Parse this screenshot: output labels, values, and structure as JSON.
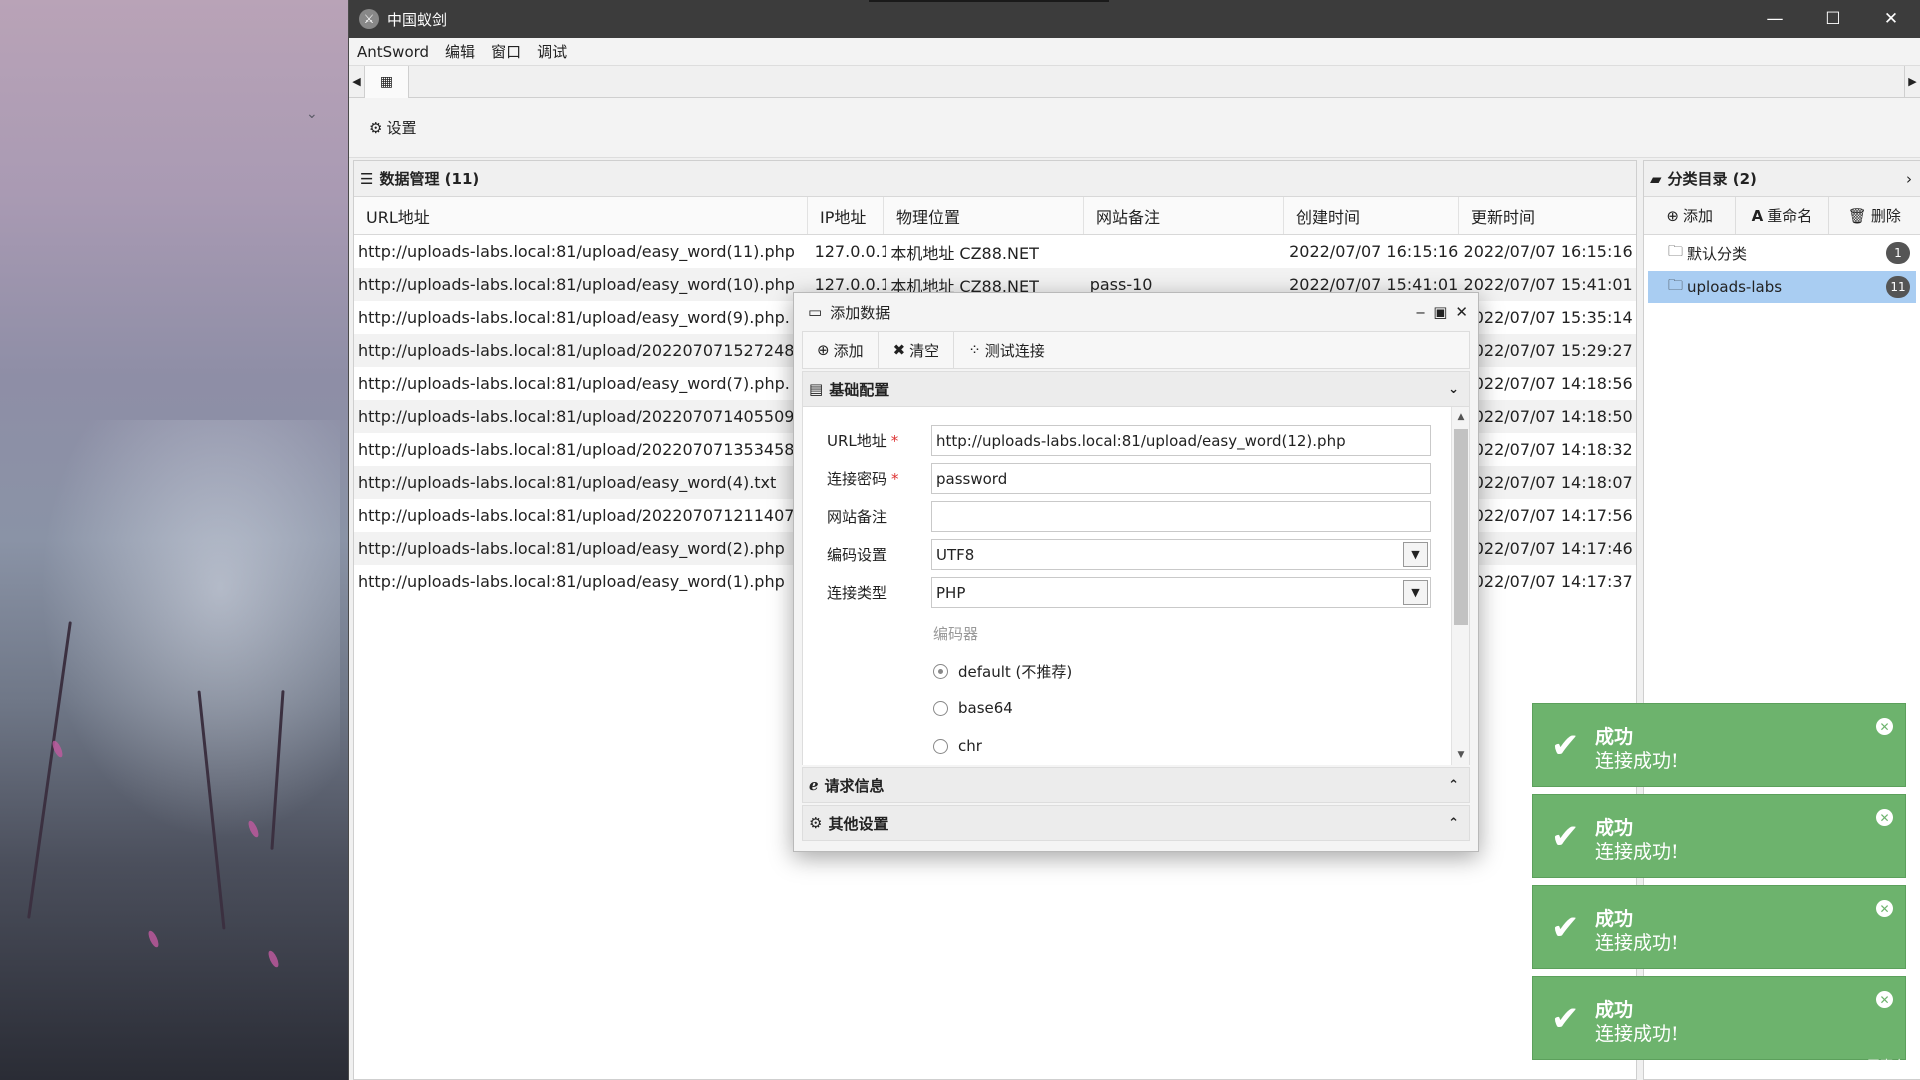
{
  "window": {
    "title": "中国蚁剑"
  },
  "menu": [
    "AntSword",
    "编辑",
    "窗口",
    "调试"
  ],
  "toolbar": {
    "settings_label": "设置"
  },
  "data_panel": {
    "title": "数据管理 (11)",
    "columns": [
      "URL地址",
      "IP地址",
      "物理位置",
      "网站备注",
      "创建时间",
      "更新时间"
    ],
    "rows": [
      [
        "http://uploads-labs.local:81/upload/easy_word(11).php",
        "127.0.0.1",
        "本机地址 CZ88.NET",
        "",
        "2022/07/07 16:15:16",
        "2022/07/07 16:15:16"
      ],
      [
        "http://uploads-labs.local:81/upload/easy_word(10).php",
        "127.0.0.1",
        "本机地址 CZ88.NET",
        "pass-10",
        "2022/07/07 15:41:01",
        "2022/07/07 15:41:01"
      ],
      [
        "http://uploads-labs.local:81/upload/easy_word(9).php.",
        "",
        "",
        "",
        "",
        "2022/07/07 15:35:14"
      ],
      [
        "http://uploads-labs.local:81/upload/202207071527248562.pl",
        "",
        "",
        "",
        "",
        "2022/07/07 15:29:27"
      ],
      [
        "http://uploads-labs.local:81/upload/easy_word(7).php.",
        "",
        "",
        "",
        "",
        "2022/07/07 14:18:56"
      ],
      [
        "http://uploads-labs.local:81/upload/202207071405509988.pl",
        "",
        "",
        "",
        "",
        "2022/07/07 14:18:50"
      ],
      [
        "http://uploads-labs.local:81/upload/202207071353458184.Pl",
        "",
        "",
        "",
        "",
        "2022/07/07 14:18:32"
      ],
      [
        "http://uploads-labs.local:81/upload/easy_word(4).txt",
        "",
        "",
        "",
        "",
        "2022/07/07 14:18:07"
      ],
      [
        "http://uploads-labs.local:81/upload/202207071211407194.pl",
        "",
        "",
        "",
        "",
        "2022/07/07 14:17:56"
      ],
      [
        "http://uploads-labs.local:81/upload/easy_word(2).php",
        "",
        "",
        "",
        "",
        "2022/07/07 14:17:46"
      ],
      [
        "http://uploads-labs.local:81/upload/easy_word(1).php",
        "",
        "",
        "",
        "",
        "2022/07/07 14:17:37"
      ]
    ]
  },
  "category_panel": {
    "title": "分类目录 (2)",
    "tools": [
      "添加",
      "重命名",
      "删除"
    ],
    "items": [
      {
        "label": "默认分类",
        "count": "1"
      },
      {
        "label": "uploads-labs",
        "count": "11"
      }
    ]
  },
  "dialog": {
    "title": "添加数据",
    "toolbar": [
      "添加",
      "清空",
      "测试连接"
    ],
    "section_basic": "基础配置",
    "fields": {
      "url_label": "URL地址",
      "url_value": "http://uploads-labs.local:81/upload/easy_word(12).php",
      "password_label": "连接密码",
      "password_value": "password",
      "note_label": "网站备注",
      "note_value": "",
      "encoding_label": "编码设置",
      "encoding_value": "UTF8",
      "type_label": "连接类型",
      "type_value": "PHP"
    },
    "encoder_title": "编码器",
    "encoders": [
      "default (不推荐)",
      "base64",
      "chr"
    ],
    "encoder_selected": "default (不推荐)",
    "section_request": "请求信息",
    "section_other": "其他设置"
  },
  "toasts": [
    {
      "title": "成功",
      "message": "连接成功!"
    },
    {
      "title": "成功",
      "message": "连接成功!"
    },
    {
      "title": "成功",
      "message": "连接成功!"
    },
    {
      "title": "成功",
      "message": "连接成功!"
    }
  ],
  "watermark": "CSDN @王嘉之",
  "colors": {
    "toast_bg": "#6db36d",
    "titlebar": "#3c3c3c",
    "selected_category": "#a9cdf2"
  }
}
